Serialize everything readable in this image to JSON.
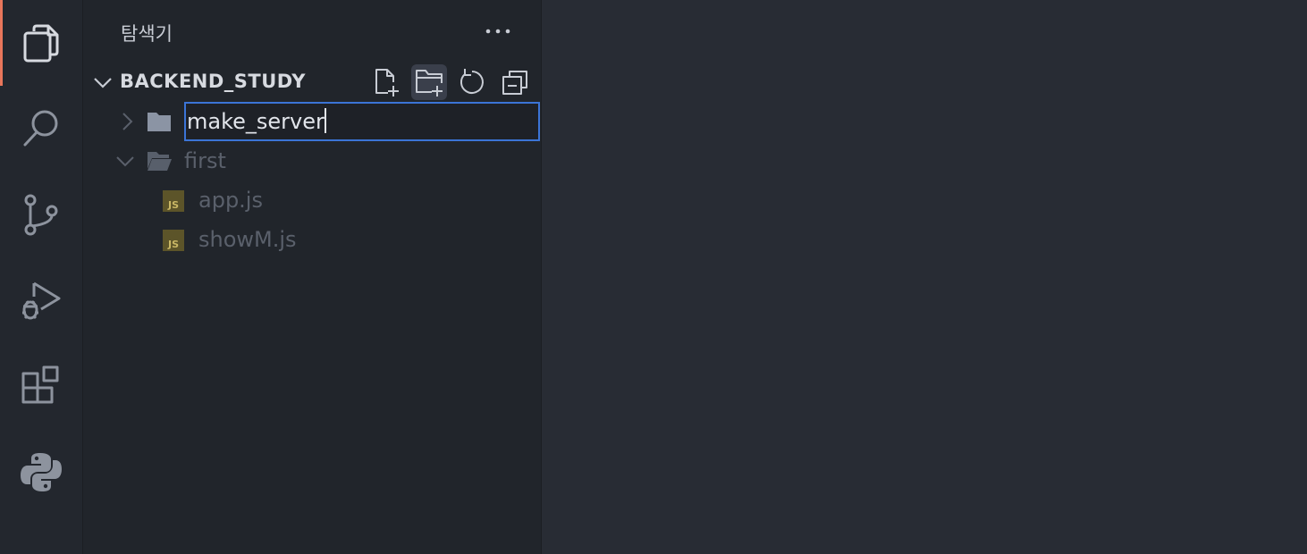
{
  "activity_bar": {
    "items": [
      {
        "icon": "explorer-icon",
        "active": true
      },
      {
        "icon": "search-icon",
        "active": false
      },
      {
        "icon": "source-control-icon",
        "active": false
      },
      {
        "icon": "run-debug-icon",
        "active": false
      },
      {
        "icon": "extensions-icon",
        "active": false
      },
      {
        "icon": "python-icon",
        "active": false
      }
    ],
    "accent_color": "#e8765b"
  },
  "sidebar": {
    "title": "탐색기",
    "more_icon": "more-actions-icon",
    "section": {
      "title": "BACKEND_STUDY",
      "actions": [
        "new-file-icon",
        "new-folder-icon",
        "refresh-icon",
        "collapse-all-icon"
      ]
    },
    "tree": {
      "rename_input_value": "make_server",
      "folder": "first",
      "files": [
        "app.js",
        "showM.js"
      ],
      "file_icon_text": "JS"
    }
  }
}
